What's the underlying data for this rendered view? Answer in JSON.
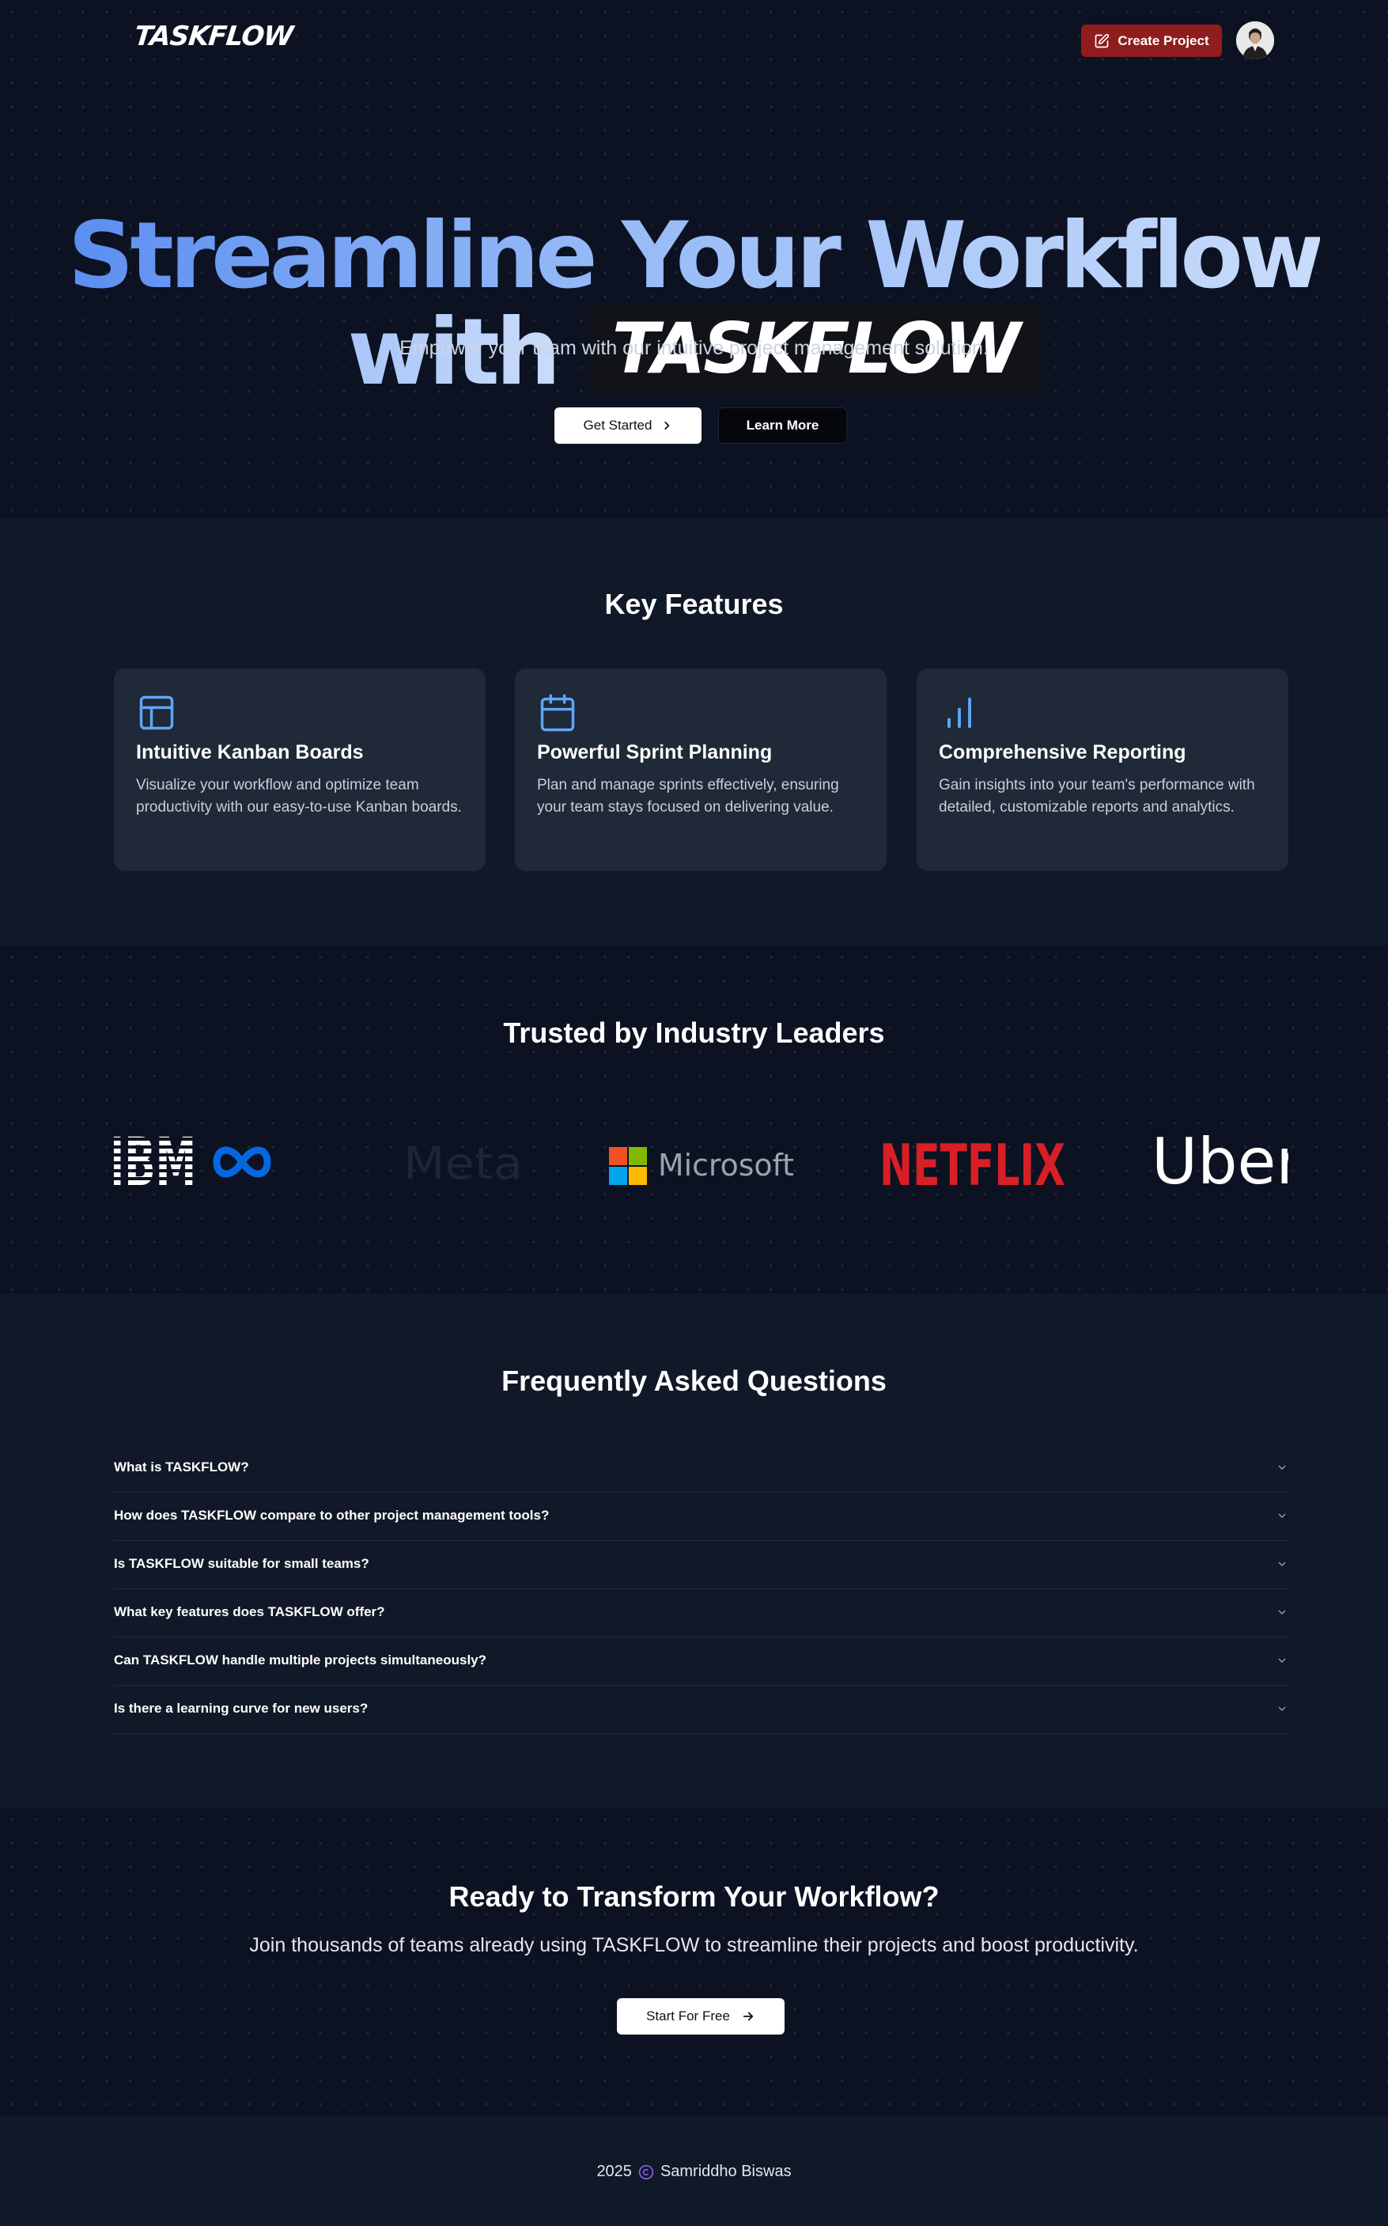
{
  "header": {
    "logo": "TASKFLOW",
    "create_button": "Create Project"
  },
  "hero": {
    "title_part1": "Streamline Your Workflow",
    "title_with": "with",
    "title_brand": "TASKFLOW",
    "subtitle": "Empower your team with our intuitive project management solution.",
    "get_started": "Get Started",
    "learn_more": "Learn More"
  },
  "features": {
    "title": "Key Features",
    "items": [
      {
        "icon": "layout-icon",
        "title": "Intuitive Kanban Boards",
        "description": "Visualize your workflow and optimize team productivity with our easy-to-use Kanban boards."
      },
      {
        "icon": "calendar-icon",
        "title": "Powerful Sprint Planning",
        "description": "Plan and manage sprints effectively, ensuring your team stays focused on delivering value."
      },
      {
        "icon": "bar-chart-icon",
        "title": "Comprehensive Reporting",
        "description": "Gain insights into your team's performance with detailed, customizable reports and analytics."
      }
    ]
  },
  "trusted": {
    "title": "Trusted by Industry Leaders",
    "logos": [
      "IBM",
      "Meta",
      "Microsoft",
      "NETFLIX",
      "Uber"
    ]
  },
  "faq": {
    "title": "Frequently Asked Questions",
    "questions": [
      "What is TASKFLOW?",
      "How does TASKFLOW compare to other project management tools?",
      "Is TASKFLOW suitable for small teams?",
      "What key features does TASKFLOW offer?",
      "Can TASKFLOW handle multiple projects simultaneously?",
      "Is there a learning curve for new users?"
    ]
  },
  "cta": {
    "title": "Ready to Transform Your Workflow?",
    "subtitle": "Join thousands of teams already using TASKFLOW to streamline their projects and boost productivity.",
    "button": "Start For Free"
  },
  "footer": {
    "year": "2025",
    "author": "Samriddho Biswas"
  },
  "colors": {
    "accent_red": "#8f1d1d",
    "icon_blue": "#60a5fa",
    "netflix_red": "#d81f26",
    "meta_blue": "#0668e1"
  }
}
